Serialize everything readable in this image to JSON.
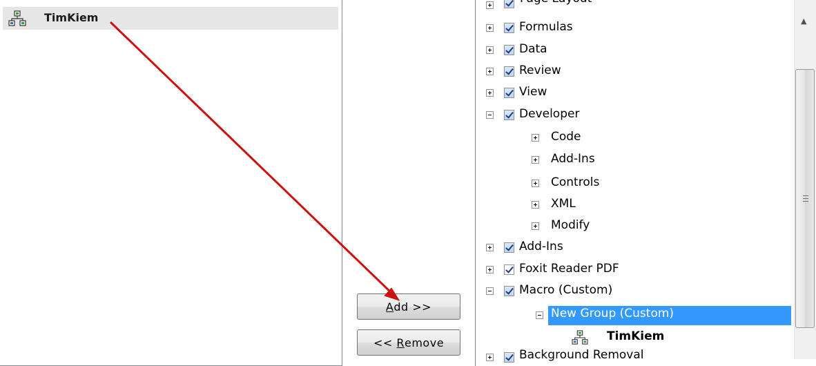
{
  "left_list": {
    "items": [
      {
        "label": "TimKiem",
        "icon": "macro-icon"
      }
    ]
  },
  "buttons": {
    "add_accel": "A",
    "add_rest": "dd >>",
    "remove_prefix": "<< ",
    "remove_accel": "R",
    "remove_rest": "emove"
  },
  "tree": {
    "top_partial": "Page Layout",
    "tabs": [
      {
        "label": "Formulas",
        "checked": true,
        "expanded": false
      },
      {
        "label": "Data",
        "checked": true,
        "expanded": false
      },
      {
        "label": "Review",
        "checked": true,
        "expanded": false
      },
      {
        "label": "View",
        "checked": true,
        "expanded": false
      },
      {
        "label": "Developer",
        "checked": true,
        "expanded": true
      }
    ],
    "developer_groups": [
      "Code",
      "Add-Ins",
      "Controls",
      "XML",
      "Modify"
    ],
    "tabs_after": [
      {
        "label": "Add-Ins",
        "checked": true,
        "expanded": false
      },
      {
        "label": "Foxit Reader PDF",
        "checked": true,
        "expanded": false
      },
      {
        "label": "Macro (Custom)",
        "checked": true,
        "expanded": true
      }
    ],
    "custom_group": "New Group (Custom)",
    "custom_command": "TimKiem",
    "bottom_partial": "Background Removal"
  },
  "annotation_color": "#cc1111",
  "selection_color": "#3399ff"
}
